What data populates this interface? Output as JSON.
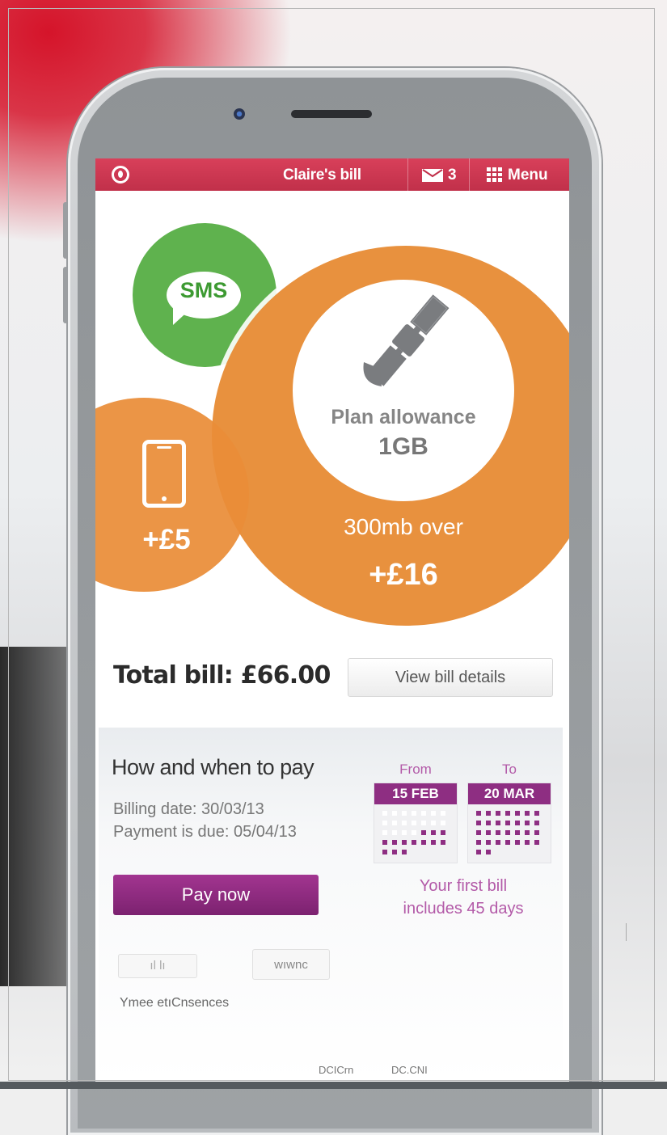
{
  "app": {
    "title": "Claire's bill",
    "messages_count": "3",
    "menu_label": "Menu",
    "brand_color": "#c8364f"
  },
  "usage": {
    "sms_label": "SMS",
    "phone_extra": "+£5",
    "plan_label": "Plan allowance",
    "plan_value": "1GB",
    "over_label": "300mb over",
    "over_amount": "+£16",
    "colors": {
      "sms": "#5fb24e",
      "data": "#e8913e"
    }
  },
  "bill": {
    "total_label": "Total bill: £66.00",
    "view_details_label": "View bill details"
  },
  "payment": {
    "heading": "How and when to pay",
    "billing_date": "Billing date: 30/03/13",
    "payment_due": "Payment is due: 05/04/13",
    "pay_now_label": "Pay now",
    "from_label": "From",
    "to_label": "To",
    "from_date": "15 FEB",
    "to_date": "20 MAR",
    "first_bill_line1": "Your first bill",
    "first_bill_line2": "includes 45 days"
  },
  "footer_blurred": {
    "chip_left": "ıl  lı",
    "chip_right": "wıwnc",
    "caption": "Ymee etıCnsences",
    "bottom_left": "DCICrn",
    "bottom_right": "DC.CNI"
  }
}
